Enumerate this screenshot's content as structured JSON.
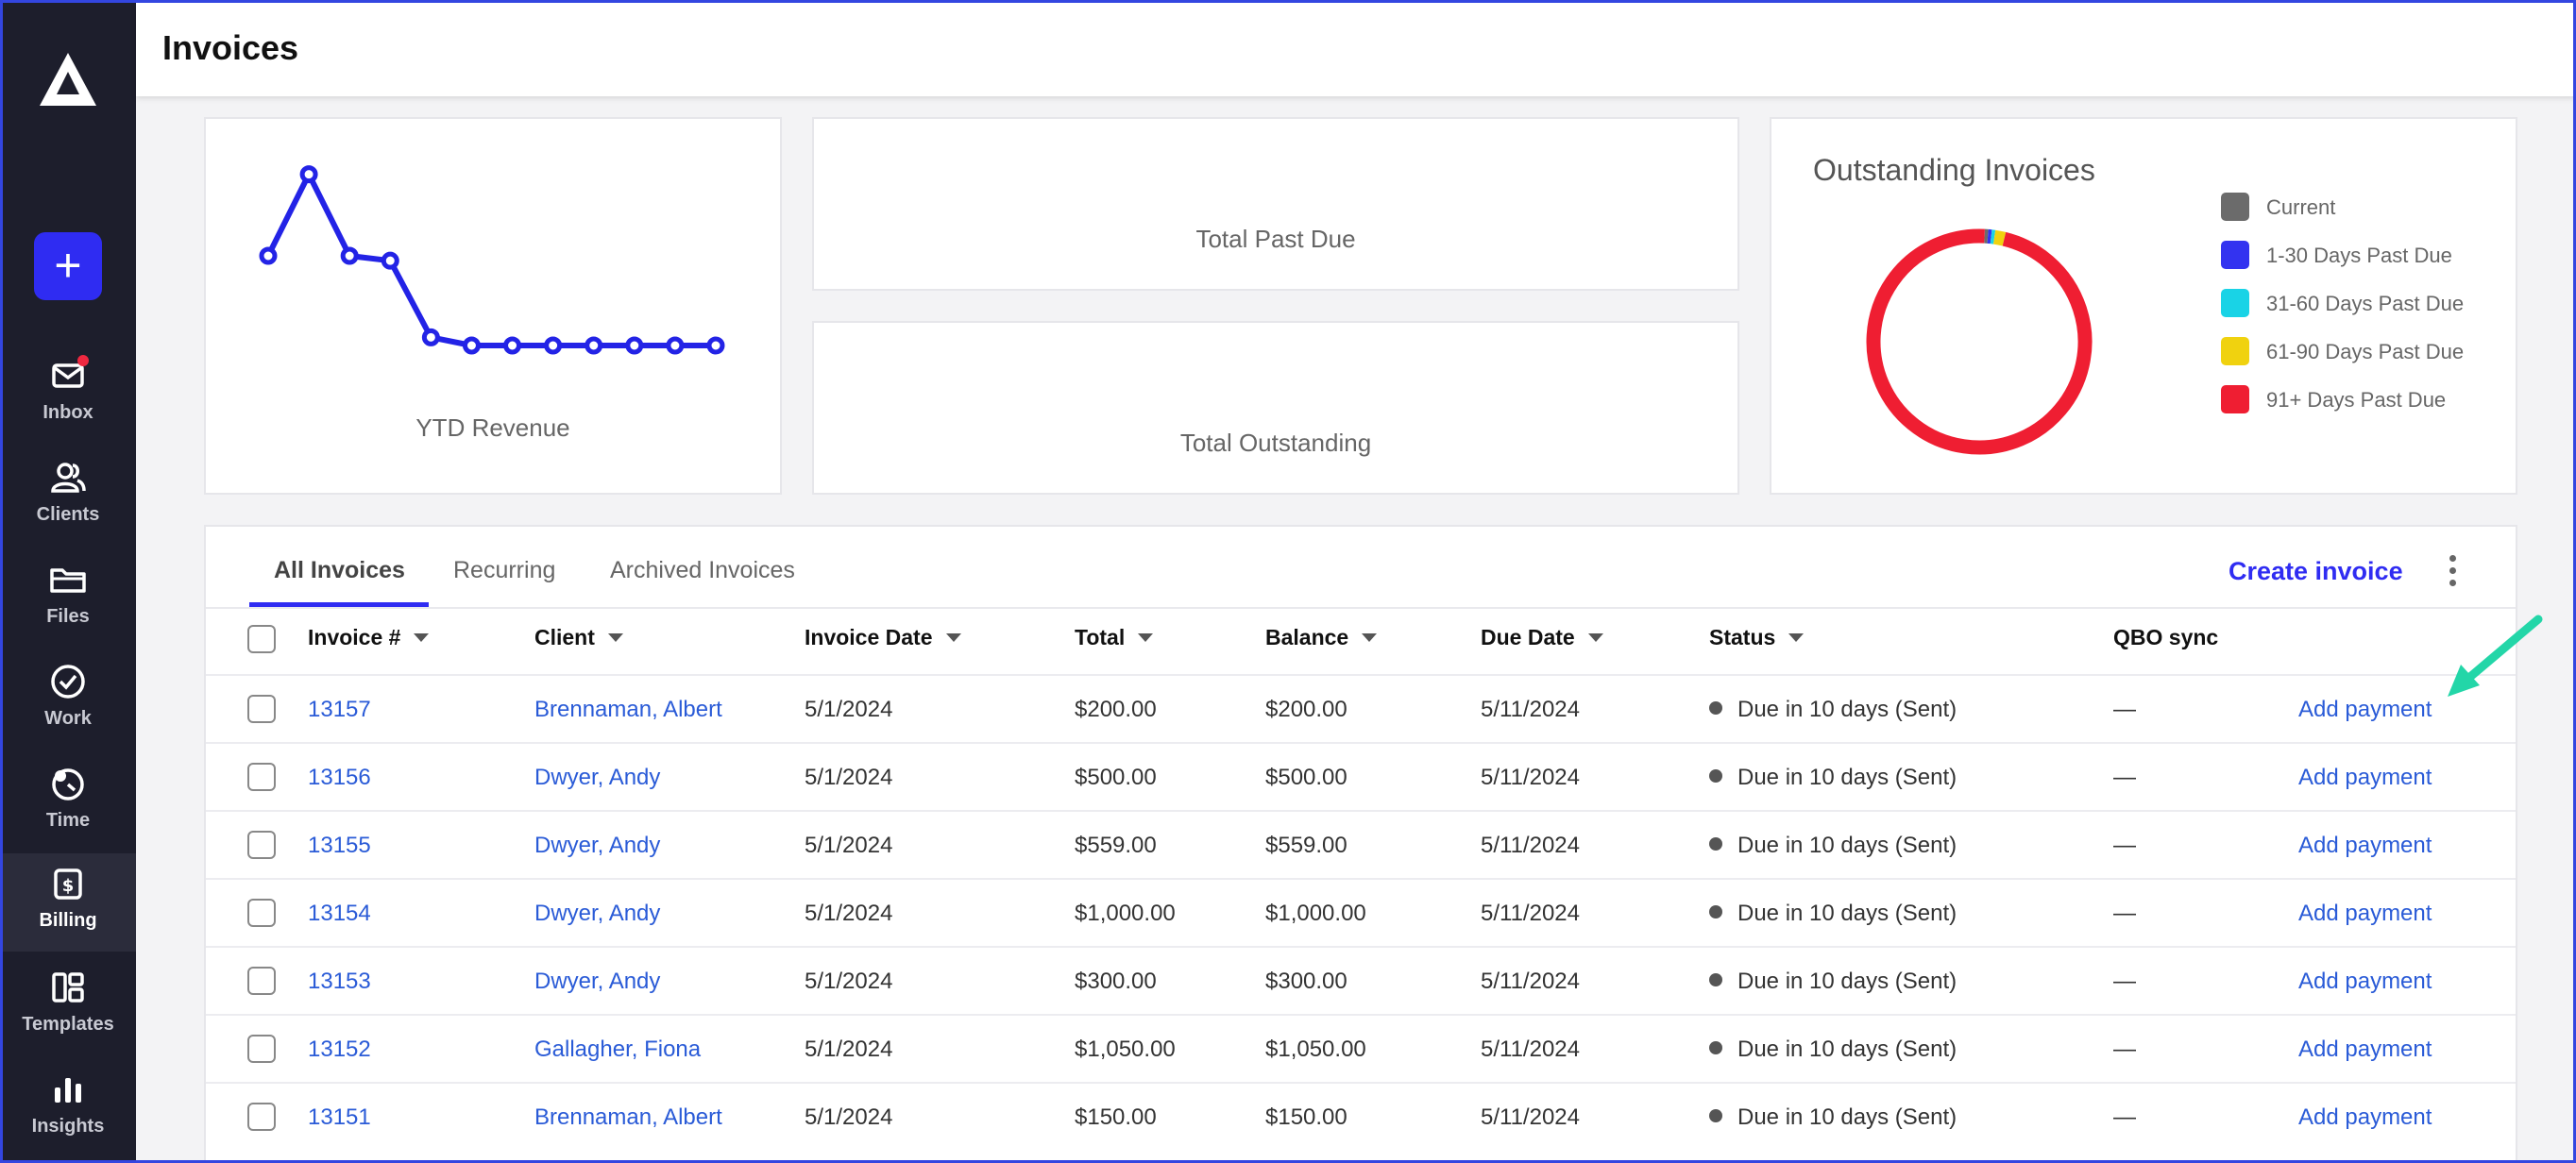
{
  "sidebar": {
    "items": [
      {
        "label": "Inbox",
        "icon": "mail-icon"
      },
      {
        "label": "Clients",
        "icon": "users-icon"
      },
      {
        "label": "Files",
        "icon": "folder-icon"
      },
      {
        "label": "Work",
        "icon": "check-circle-icon"
      },
      {
        "label": "Time",
        "icon": "clock-icon"
      },
      {
        "label": "Billing",
        "icon": "dollar-doc-icon",
        "active": true
      },
      {
        "label": "Templates",
        "icon": "templates-icon"
      },
      {
        "label": "Insights",
        "icon": "bar-chart-icon"
      }
    ],
    "add_label": "+"
  },
  "header": {
    "title": "Invoices"
  },
  "cards": {
    "ytd_revenue": {
      "label": "YTD Revenue"
    },
    "total_past_due": {
      "label": "Total Past Due"
    },
    "total_outstanding": {
      "label": "Total Outstanding"
    },
    "outstanding_invoices": {
      "title": "Outstanding Invoices"
    }
  },
  "chart_data": [
    {
      "type": "line",
      "title": "",
      "xlabel": "YTD Revenue",
      "ylabel": "",
      "series": [
        {
          "values": [
            0.45,
            0.95,
            0.45,
            0.42,
            -0.05,
            -0.1,
            -0.1,
            -0.1,
            -0.1,
            -0.1,
            -0.1,
            -0.1
          ]
        }
      ],
      "color": "#2323e6"
    },
    {
      "type": "pie",
      "title": "Outstanding Invoices",
      "labels": [
        "Current",
        "1-30 Days Past Due",
        "31-60 Days Past Due",
        "61-90 Days Past Due",
        "91+ Days Past Due"
      ],
      "values": [
        0.5,
        0.5,
        0.5,
        1.5,
        97
      ],
      "colors": [
        "#6b6b6b",
        "#3333f0",
        "#19d3e6",
        "#f0d20f",
        "#ef1e32"
      ],
      "legend": "right"
    }
  ],
  "table": {
    "tabs": [
      "All Invoices",
      "Recurring",
      "Archived Invoices"
    ],
    "create_label": "Create invoice",
    "headers": {
      "invoice": "Invoice #",
      "client": "Client",
      "invoice_date": "Invoice Date",
      "total": "Total",
      "balance": "Balance",
      "due_date": "Due Date",
      "status": "Status",
      "qbo": "QBO sync"
    },
    "rows": [
      {
        "invoice": "13157",
        "client": "Brennaman, Albert",
        "date": "5/1/2024",
        "total": "$200.00",
        "balance": "$200.00",
        "due": "5/11/2024",
        "status": "Due in 10 days (Sent)",
        "qbo": "—",
        "action": "Add payment"
      },
      {
        "invoice": "13156",
        "client": "Dwyer, Andy",
        "date": "5/1/2024",
        "total": "$500.00",
        "balance": "$500.00",
        "due": "5/11/2024",
        "status": "Due in 10 days (Sent)",
        "qbo": "—",
        "action": "Add payment"
      },
      {
        "invoice": "13155",
        "client": "Dwyer, Andy",
        "date": "5/1/2024",
        "total": "$559.00",
        "balance": "$559.00",
        "due": "5/11/2024",
        "status": "Due in 10 days (Sent)",
        "qbo": "—",
        "action": "Add payment"
      },
      {
        "invoice": "13154",
        "client": "Dwyer, Andy",
        "date": "5/1/2024",
        "total": "$1,000.00",
        "balance": "$1,000.00",
        "due": "5/11/2024",
        "status": "Due in 10 days (Sent)",
        "qbo": "—",
        "action": "Add payment"
      },
      {
        "invoice": "13153",
        "client": "Dwyer, Andy",
        "date": "5/1/2024",
        "total": "$300.00",
        "balance": "$300.00",
        "due": "5/11/2024",
        "status": "Due in 10 days (Sent)",
        "qbo": "—",
        "action": "Add payment"
      },
      {
        "invoice": "13152",
        "client": "Gallagher, Fiona",
        "date": "5/1/2024",
        "total": "$1,050.00",
        "balance": "$1,050.00",
        "due": "5/11/2024",
        "status": "Due in 10 days (Sent)",
        "qbo": "—",
        "action": "Add payment"
      },
      {
        "invoice": "13151",
        "client": "Brennaman, Albert",
        "date": "5/1/2024",
        "total": "$150.00",
        "balance": "$150.00",
        "due": "5/11/2024",
        "status": "Due in 10 days (Sent)",
        "qbo": "—",
        "action": "Add payment"
      }
    ]
  }
}
